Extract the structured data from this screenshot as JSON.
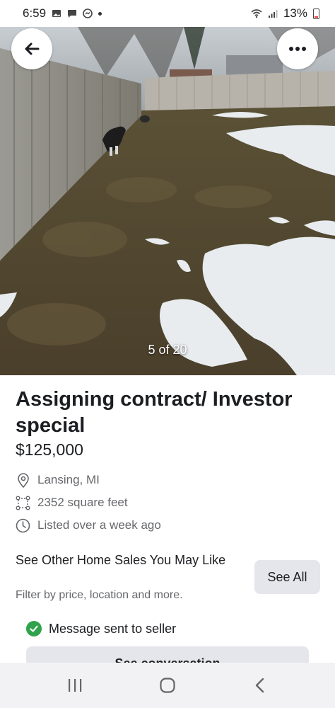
{
  "status_bar": {
    "time": "6:59",
    "battery": "13%",
    "icons": [
      "image-icon",
      "chat-icon",
      "messenger-icon",
      "dot-icon",
      "wifi-icon",
      "signal-icon",
      "battery-icon"
    ]
  },
  "photo": {
    "counter": "5 of 20",
    "back_icon": "arrow-left-icon",
    "more_icon": "more-horizontal-icon"
  },
  "listing": {
    "title": "Assigning contract/ Investor special",
    "price": "$125,000",
    "location": "Lansing, MI",
    "size": "2352 square feet",
    "listed": "Listed over a week ago"
  },
  "promo": {
    "title": "See Other Home Sales You May Like",
    "subtitle": "Filter by price, location and more.",
    "button": "See All"
  },
  "message": {
    "status": "Message sent to seller",
    "button": "See conversation"
  },
  "nav_bar": {
    "icons": [
      "recent-apps-icon",
      "home-icon",
      "back-icon"
    ]
  },
  "colors": {
    "success": "#31a24c",
    "button_bg": "#e4e6eb",
    "secondary_text": "#65676b"
  }
}
